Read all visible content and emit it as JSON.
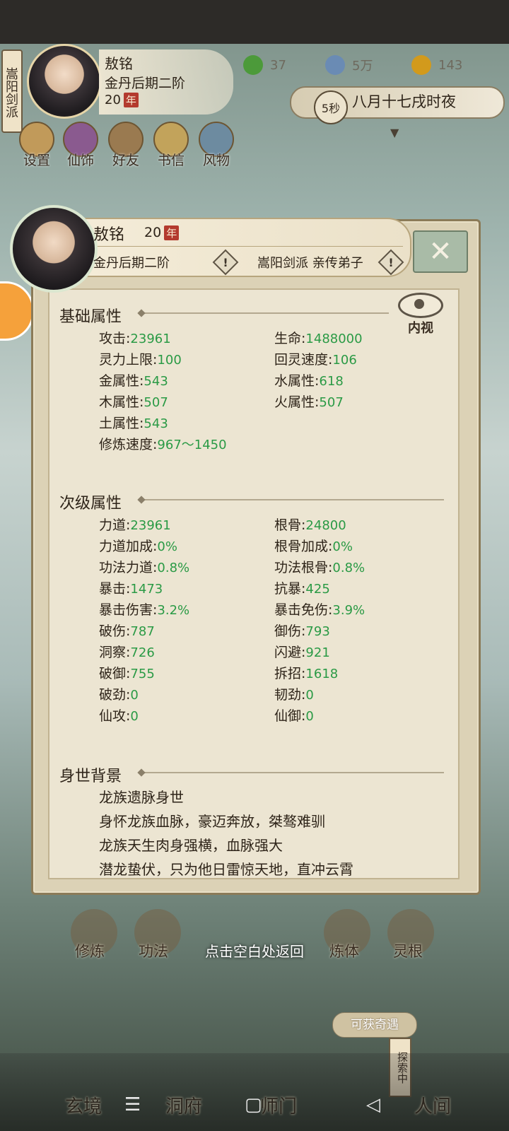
{
  "header": {
    "sect": "嵩阳剑派",
    "name": "敖铭",
    "realm": "金丹后期二阶",
    "age": "20",
    "age_unit": "年"
  },
  "resources": [
    {
      "value": "37",
      "icon": "leaf-currency-icon",
      "color": "#4c9a3a"
    },
    {
      "value": "5万",
      "icon": "coin-icon",
      "color": "#6a8bb4"
    },
    {
      "value": "143",
      "icon": "gold-ingot-icon",
      "color": "#d29a1c"
    }
  ],
  "time": {
    "countdown": "5秒",
    "date": "八月十七戌时夜"
  },
  "top_menu": [
    "设置",
    "仙饰",
    "好友",
    "书信",
    "风物"
  ],
  "modal": {
    "name": "敖铭",
    "age": "20",
    "age_unit": "年",
    "realm": "金丹后期二阶",
    "sect": "嵩阳剑派 亲传弟子",
    "eye_label": "内视",
    "sections": {
      "basic": "基础属性",
      "secondary": "次级属性",
      "background": "身世背景"
    },
    "basic_attrs": [
      {
        "label": "攻击",
        "value": "23961"
      },
      {
        "label": "生命",
        "value": "1488000"
      },
      {
        "label": "灵力上限",
        "value": "100"
      },
      {
        "label": "回灵速度",
        "value": "106"
      },
      {
        "label": "金属性",
        "value": "543"
      },
      {
        "label": "水属性",
        "value": "618"
      },
      {
        "label": "木属性",
        "value": "507"
      },
      {
        "label": "火属性",
        "value": "507"
      },
      {
        "label": "土属性",
        "value": "543"
      },
      {
        "label": "修炼速度",
        "value": "967～1450"
      }
    ],
    "secondary_attrs": [
      {
        "label": "力道",
        "value": "23961"
      },
      {
        "label": "根骨",
        "value": "24800"
      },
      {
        "label": "力道加成",
        "value": "0%"
      },
      {
        "label": "根骨加成",
        "value": "0%"
      },
      {
        "label": "功法力道",
        "value": "0.8%"
      },
      {
        "label": "功法根骨",
        "value": "0.8%"
      },
      {
        "label": "暴击",
        "value": "1473"
      },
      {
        "label": "抗暴",
        "value": "425"
      },
      {
        "label": "暴击伤害",
        "value": "3.2%"
      },
      {
        "label": "暴击免伤",
        "value": "3.9%"
      },
      {
        "label": "破伤",
        "value": "787"
      },
      {
        "label": "御伤",
        "value": "793"
      },
      {
        "label": "洞察",
        "value": "726"
      },
      {
        "label": "闪避",
        "value": "921"
      },
      {
        "label": "破御",
        "value": "755"
      },
      {
        "label": "拆招",
        "value": "1618"
      },
      {
        "label": "破劲",
        "value": "0"
      },
      {
        "label": "韧劲",
        "value": "0"
      },
      {
        "label": "仙攻",
        "value": "0"
      },
      {
        "label": "仙御",
        "value": "0"
      }
    ],
    "background_lines": [
      "龙族遗脉身世",
      "身怀龙族血脉，豪迈奔放，桀骜难驯",
      "龙族天生肉身强横，血脉强大",
      "潜龙蛰伏，只为他日雷惊天地，直冲云霄"
    ]
  },
  "bottom_menu": [
    "修炼",
    "功法",
    "炼体",
    "灵根"
  ],
  "hint": "点击空白处返回",
  "opportunity": "可获奇遇",
  "explore": "探索中",
  "nav": [
    "玄境",
    "洞府",
    "师门",
    "人间"
  ]
}
